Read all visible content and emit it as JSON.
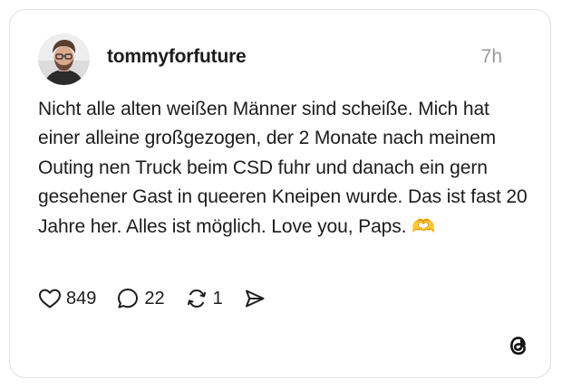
{
  "post": {
    "username": "tommyforfuture",
    "time": "7h",
    "text": "Nicht alle alten weißen Männer sind scheiße. Mich hat einer alleine großgezogen, der 2 Monate nach meinem Outing nen Truck beim CSD fuhr und danach ein gern gesehener Gast in queeren Kneipen wurde. Das ist fast 20 Jahre her. Alles ist möglich. Love you, Paps. 🫶",
    "avatar_icon": "profile-photo"
  },
  "actions": {
    "likes": "849",
    "replies": "22",
    "reposts": "1",
    "like_icon": "heart-icon",
    "reply_icon": "comment-icon",
    "repost_icon": "repost-icon",
    "share_icon": "send-icon"
  },
  "branding": {
    "logo": "threads-logo"
  },
  "colors": {
    "text": "#1c1c1c",
    "muted": "#9a9a9a",
    "border": "#e1e1e1",
    "emoji": "#f5c542"
  }
}
